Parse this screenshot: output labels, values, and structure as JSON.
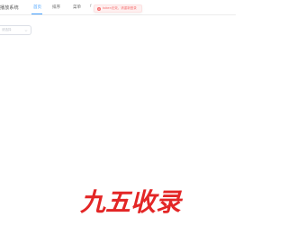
{
  "header": {
    "brand": "播放系统",
    "nav": [
      {
        "label": "首页",
        "active": true
      },
      {
        "label": "排序",
        "active": false
      },
      {
        "label": "菜单",
        "active": false
      },
      {
        "label": "f",
        "active": false
      }
    ]
  },
  "toast": {
    "icon": "error-circle-icon",
    "icon_glyph": "×",
    "text": "token无效，请重新登录",
    "color": "#f56c6c"
  },
  "search": {
    "placeholder": "请选择"
  },
  "logo": {
    "text": "九五收录",
    "color": "#e32626"
  },
  "colors": {
    "accent": "#409eff",
    "error": "#f56c6c"
  }
}
